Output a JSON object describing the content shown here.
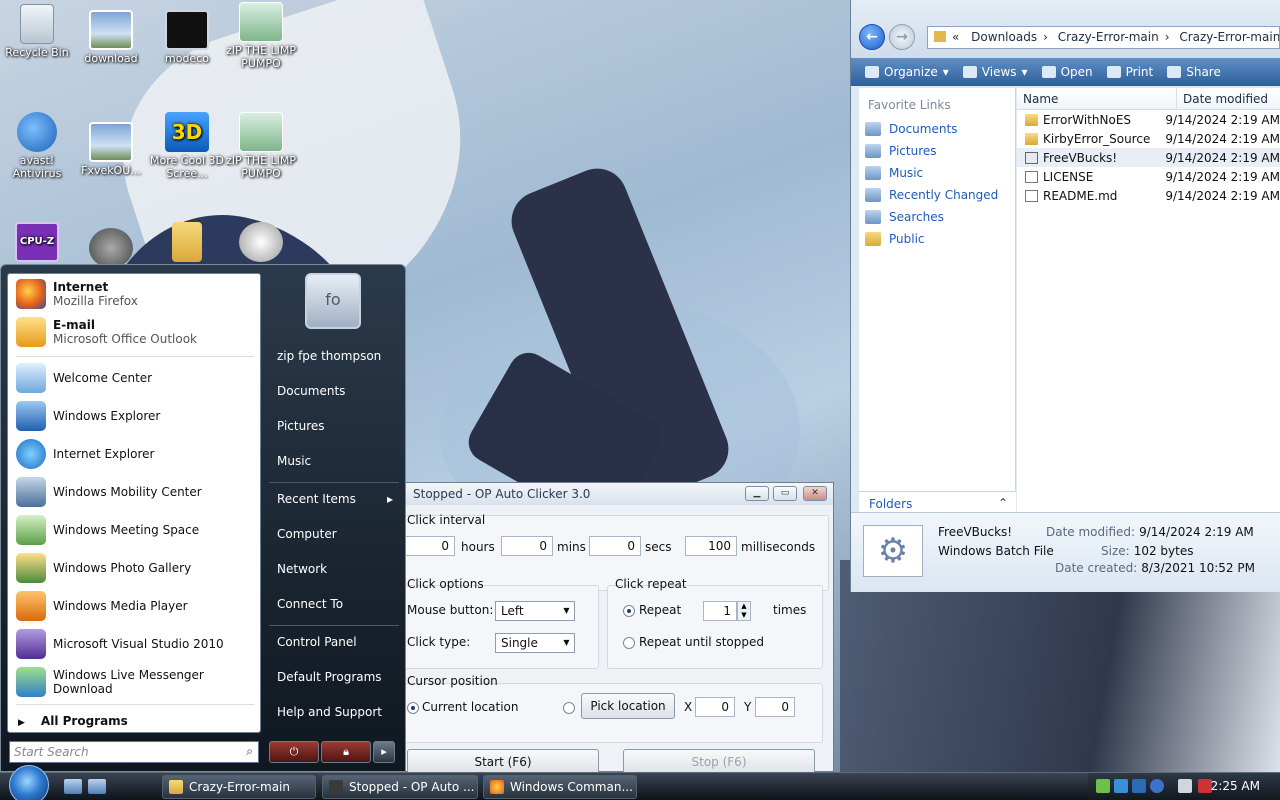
{
  "desktop": {
    "icons": [
      {
        "label": "Recycle Bin"
      },
      {
        "label": "download"
      },
      {
        "label": "modeco"
      },
      {
        "label": "zIP THE LIMP PUMPO"
      },
      {
        "label": "avast! Antivirus"
      },
      {
        "label": "FxvekOU..."
      },
      {
        "label": "More Cool 3D Scree..."
      },
      {
        "label": "zIP THE LIMP PUMPO"
      }
    ],
    "cpu_icon_text": "CPU-Z",
    "three_d_text": "3D"
  },
  "explorer": {
    "address": [
      "Downloads",
      "Crazy-Error-main",
      "Crazy-Error-main"
    ],
    "address_prefix": "«",
    "toolbar": {
      "organize": "Organize",
      "views": "Views",
      "open": "Open",
      "print": "Print",
      "share": "Share"
    },
    "favorites_title": "Favorite Links",
    "favorites": [
      "Documents",
      "Pictures",
      "Music",
      "Recently Changed",
      "Searches",
      "Public"
    ],
    "folders_label": "Folders",
    "columns": {
      "name": "Name",
      "date": "Date modified"
    },
    "files": [
      {
        "name": "ErrorWithNoES",
        "date": "9/14/2024 2:19 AM",
        "type": "folder"
      },
      {
        "name": "KirbyError_Source",
        "date": "9/14/2024 2:19 AM",
        "type": "folder"
      },
      {
        "name": "FreeVBucks!",
        "date": "9/14/2024 2:19 AM",
        "type": "bat"
      },
      {
        "name": "LICENSE",
        "date": "9/14/2024 2:19 AM",
        "type": "file"
      },
      {
        "name": "README.md",
        "date": "9/14/2024 2:19 AM",
        "type": "file"
      }
    ],
    "details": {
      "name": "FreeVBucks!",
      "type": "Windows Batch File",
      "modified_label": "Date modified:",
      "modified": "9/14/2024 2:19 AM",
      "size_label": "Size:",
      "size": "102 bytes",
      "created_label": "Date created:",
      "created": "8/3/2021 10:52 PM"
    }
  },
  "clicker": {
    "title": "Stopped - OP Auto Clicker 3.0",
    "interval_label": "Click interval",
    "hours": "0",
    "hours_label": "hours",
    "mins": "0",
    "mins_label": "mins",
    "secs": "0",
    "secs_label": "secs",
    "ms": "100",
    "ms_label": "milliseconds",
    "options_label": "Click options",
    "mouse_button_label": "Mouse button:",
    "mouse_button": "Left",
    "click_type_label": "Click type:",
    "click_type": "Single",
    "repeat_group": "Click repeat",
    "repeat_label": "Repeat",
    "repeat_value": "1",
    "times_label": "times",
    "repeat_until": "Repeat until stopped",
    "cursor_group": "Cursor position",
    "current_location": "Current location",
    "pick_location": "Pick location",
    "x_label": "X",
    "x_value": "0",
    "y_label": "Y",
    "y_value": "0",
    "start": "Start (F6)",
    "stop": "Stop (F6)"
  },
  "startmenu": {
    "pinned": [
      {
        "title": "Internet",
        "sub": "Mozilla Firefox"
      },
      {
        "title": "E-mail",
        "sub": "Microsoft Office Outlook"
      }
    ],
    "recent": [
      "Welcome Center",
      "Windows Explorer",
      "Internet Explorer",
      "Windows Mobility Center",
      "Windows Meeting Space",
      "Windows Photo Gallery",
      "Windows Media Player",
      "Microsoft Visual Studio 2010",
      "Windows Live Messenger Download"
    ],
    "all_programs": "All Programs",
    "search_placeholder": "Start Search",
    "user": "zip fpe thompson",
    "avatar_text": "fo",
    "right": [
      "Documents",
      "Pictures",
      "Music",
      "Recent Items",
      "Computer",
      "Network",
      "Connect To",
      "Control Panel",
      "Default Programs",
      "Help and Support"
    ]
  },
  "taskbar": {
    "tasks": [
      "Crazy-Error-main",
      "Stopped - OP Auto ...",
      "Windows Comman..."
    ],
    "clock": "2:25 AM"
  },
  "colors": {
    "accent": "#1d5bb8",
    "taskbar": "#1b232c"
  }
}
